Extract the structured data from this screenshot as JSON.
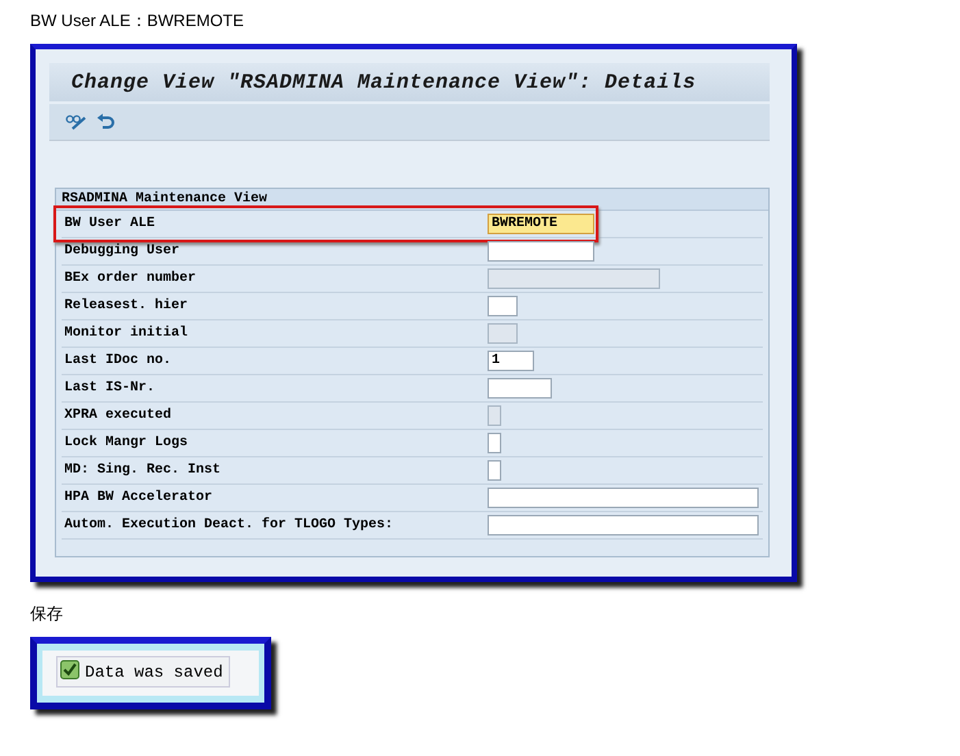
{
  "caption": "BW User ALE：BWREMOTE",
  "window": {
    "title": "Change View \"RSADMINA Maintenance View\": Details"
  },
  "group": {
    "title": "RSADMINA Maintenance View",
    "fields": [
      {
        "label": "BW User ALE",
        "value": "BWREMOTE",
        "kind": "medium",
        "disabled": false,
        "highlighted": true
      },
      {
        "label": "Debugging User",
        "kind": "medium",
        "disabled": false,
        "highlighted": false
      },
      {
        "label": "BEx order number",
        "kind": "long",
        "disabled": true,
        "highlighted": false
      },
      {
        "label": "Releasest. hier",
        "kind": "tiny",
        "disabled": false,
        "highlighted": false
      },
      {
        "label": "Monitor initial",
        "kind": "tiny",
        "disabled": true,
        "highlighted": false
      },
      {
        "label": "Last IDoc no.",
        "value": "1",
        "kind": "short",
        "disabled": false,
        "highlighted": false
      },
      {
        "label": "Last IS-Nr.",
        "kind": "number",
        "disabled": false,
        "highlighted": false
      },
      {
        "label": "XPRA executed",
        "kind": "flag",
        "disabled": true,
        "highlighted": false
      },
      {
        "label": "Lock Mangr Logs",
        "kind": "flag",
        "disabled": false,
        "highlighted": false
      },
      {
        "label": "MD: Sing. Rec. Inst",
        "kind": "flag",
        "disabled": false,
        "highlighted": false
      },
      {
        "label": "HPA BW Accelerator",
        "kind": "wide",
        "disabled": false,
        "highlighted": false
      },
      {
        "label": "Autom. Execution Deact. for TLOGO Types:",
        "kind": "wide",
        "disabled": false,
        "highlighted": false
      }
    ]
  },
  "save_caption": "保存",
  "message": {
    "text": "Data was saved",
    "kind": "success"
  }
}
